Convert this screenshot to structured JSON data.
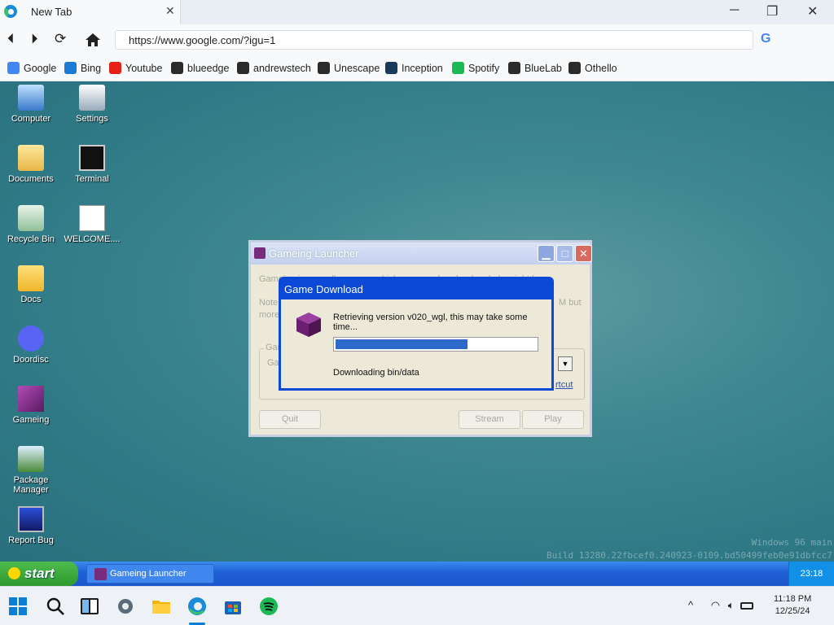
{
  "browser": {
    "tab_title": "New Tab",
    "tab_close": "✕",
    "url": "https://www.google.com/?igu=1",
    "window_controls": [
      "─",
      "❐",
      "✕"
    ],
    "bookmarks": [
      {
        "label": "Google",
        "icon": "google-icon",
        "color": "#4285f4"
      },
      {
        "label": "Bing",
        "icon": "bing-icon",
        "color": "#1c7cd5"
      },
      {
        "label": "Youtube",
        "icon": "youtube-icon",
        "color": "#e62117"
      },
      {
        "label": "blueedge",
        "icon": "react-icon",
        "color": "#2b2b2b"
      },
      {
        "label": "andrewstech",
        "icon": "terminal-icon",
        "color": "#2b2b2b"
      },
      {
        "label": "Unescape",
        "icon": "react-icon",
        "color": "#2b2b2b"
      },
      {
        "label": "Inception",
        "icon": "inception-icon",
        "color": "#1a3a5a"
      },
      {
        "label": "Spotify",
        "icon": "spotify-icon",
        "color": "#1db954"
      },
      {
        "label": "BlueLab",
        "icon": "react-icon",
        "color": "#2b2b2b"
      },
      {
        "label": "Othello",
        "icon": "react-icon",
        "color": "#2b2b2b"
      }
    ]
  },
  "desktop": {
    "icons": [
      {
        "label": "Computer",
        "icon": "computer-icon"
      },
      {
        "label": "Settings",
        "icon": "settings-icon"
      },
      {
        "label": "Documents",
        "icon": "documents-icon"
      },
      {
        "label": "Terminal",
        "icon": "terminal-icon"
      },
      {
        "label": "Recycle Bin",
        "icon": "recycle-bin-icon"
      },
      {
        "label": "WELCOME....",
        "icon": "markdown-icon"
      },
      {
        "label": "Docs",
        "icon": "folder-icon"
      },
      {
        "label": "Doordisc",
        "icon": "discord-icon"
      },
      {
        "label": "Gameing",
        "icon": "cube-icon"
      },
      {
        "label": "Package Manager",
        "icon": "package-manager-icon"
      },
      {
        "label": "Report Bug",
        "icon": "report-bug-icon"
      }
    ],
    "watermark_line1": "Windows 96 main",
    "watermark_line2": "Build 13280.22fbcef0.240923-0109.bd50499feb0e91dbfcc7"
  },
  "launcher": {
    "title": "Gameing Launcher",
    "intro_text": "Gameing is a sandbox game which you can download and play right here.",
    "note_prefix": "Note:",
    "note_suffix": "M but",
    "note_line2": "more",
    "group_label": "Gam",
    "select_label": "Gam",
    "shortcut_link": "rtcut",
    "quit_label": "Quit",
    "stream_label": "Stream",
    "play_label": "Play",
    "ctl_min": "▁",
    "ctl_max": "□",
    "ctl_close": "✕"
  },
  "download_dialog": {
    "title": "Game Download",
    "message": "Retrieving version v020_wgl, this may take some time...",
    "progress": 0.66,
    "status": "Downloading bin/data"
  },
  "xp_taskbar": {
    "start_label": "start",
    "task_label": "Gameing Launcher",
    "clock": "23:18"
  },
  "win11_taskbar": {
    "apps": [
      "windows-start-icon",
      "search-icon",
      "task-view-icon",
      "settings-icon",
      "file-explorer-icon",
      "edge-icon",
      "store-icon",
      "spotify-icon"
    ],
    "time": "11:18 PM",
    "date": "12/25/24",
    "tray_chevron": "^"
  },
  "colors": {
    "xp_title_blue": "#0b49d6",
    "progress_fill": "#2e6ac9",
    "desktop_teal": "#3f8891"
  }
}
